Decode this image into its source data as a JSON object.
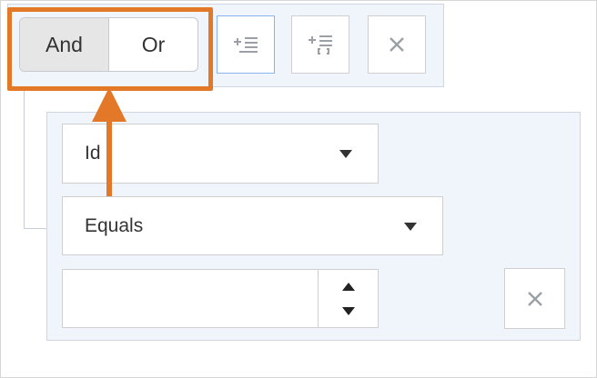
{
  "group": {
    "combinator": {
      "options": [
        "And",
        "Or"
      ],
      "selected": "And"
    },
    "actions": [
      {
        "name": "add-rule-button",
        "icon": "add-rule-icon"
      },
      {
        "name": "add-group-button",
        "icon": "add-group-icon"
      },
      {
        "name": "delete-group-button",
        "icon": "close-icon"
      }
    ]
  },
  "rule": {
    "field": "Id",
    "operator": "Equals",
    "value": "",
    "delete_icon": "close-icon"
  },
  "annotation": {
    "highlight_color": "#e37829"
  },
  "colors": {
    "panel_bg": "#f0f4fb",
    "accent_border": "#8ab4f0",
    "highlight": "#e37829"
  }
}
